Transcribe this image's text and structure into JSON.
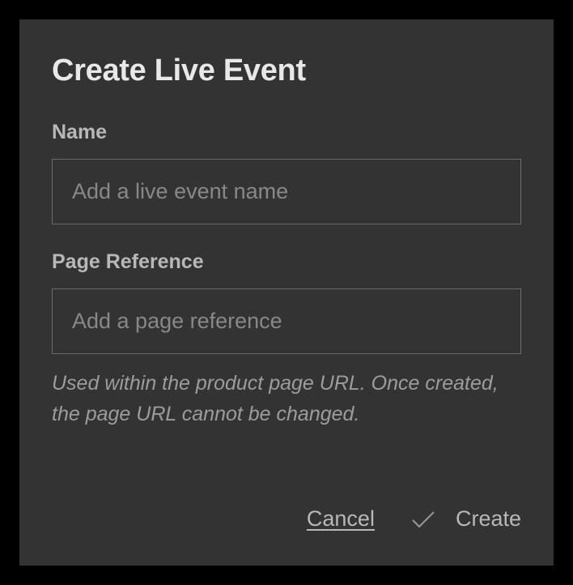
{
  "dialog": {
    "title": "Create Live Event",
    "fields": {
      "name": {
        "label": "Name",
        "placeholder": "Add a live event name",
        "value": ""
      },
      "pageReference": {
        "label": "Page Reference",
        "placeholder": "Add a page reference",
        "value": "",
        "helper": "Used within the product page URL. Once created, the page URL cannot be changed."
      }
    },
    "actions": {
      "cancel": "Cancel",
      "create": "Create"
    }
  }
}
